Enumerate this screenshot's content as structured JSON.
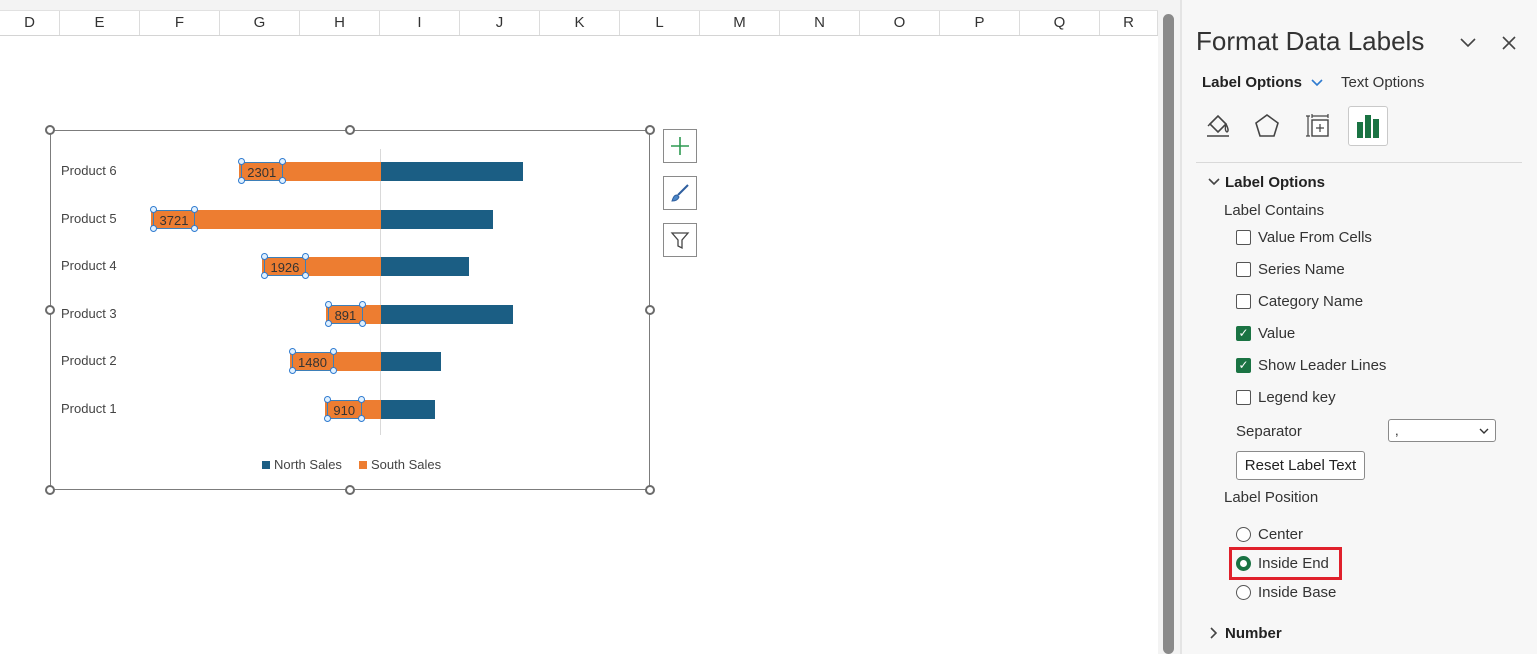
{
  "sheet": {
    "columns": [
      "D",
      "E",
      "F",
      "G",
      "H",
      "I",
      "J",
      "K",
      "L",
      "M",
      "N",
      "O",
      "P",
      "Q",
      "R"
    ]
  },
  "chart_data": {
    "type": "bar",
    "orientation": "horizontal-diverging",
    "categories": [
      "Product 6",
      "Product 5",
      "Product 4",
      "Product 3",
      "Product 2",
      "Product 1"
    ],
    "series": [
      {
        "name": "North Sales",
        "color": "#1b5e84",
        "values": [
          2301,
          1820,
          1428,
          2140,
          975,
          870
        ]
      },
      {
        "name": "South Sales",
        "color": "#ed7d31",
        "values": [
          2301,
          3721,
          1926,
          891,
          1480,
          910
        ]
      }
    ],
    "data_labels": [
      "2301",
      "3721",
      "1926",
      "891",
      "1480",
      "910"
    ],
    "legend": [
      "North Sales",
      "South Sales"
    ],
    "legend_position": "bottom"
  },
  "chart_buttons": [
    "chart-elements-button",
    "chart-styles-button",
    "chart-filters-button"
  ],
  "pane": {
    "title": "Format Data Labels",
    "tabs": {
      "label_options": "Label Options",
      "text_options": "Text Options"
    },
    "sections": {
      "label_options": "Label Options",
      "number": "Number"
    },
    "label_contains": "Label Contains",
    "checkboxes": [
      {
        "label": "Value From Cells",
        "checked": false
      },
      {
        "label": "Series Name",
        "checked": false
      },
      {
        "label": "Category Name",
        "checked": false
      },
      {
        "label": "Value",
        "checked": true
      },
      {
        "label": "Show Leader Lines",
        "checked": true
      },
      {
        "label": "Legend key",
        "checked": false
      }
    ],
    "separator_label": "Separator",
    "separator_value": ",",
    "reset_button": "Reset Label Text",
    "label_position": "Label Position",
    "positions": [
      {
        "label": "Center",
        "selected": false
      },
      {
        "label": "Inside End",
        "selected": true
      },
      {
        "label": "Inside Base",
        "selected": false
      }
    ]
  }
}
